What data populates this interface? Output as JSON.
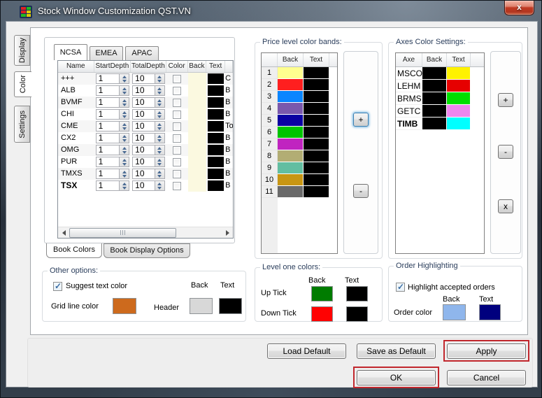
{
  "window": {
    "title": "Stock Window Customization QST.VN",
    "close_glyph": "x"
  },
  "annotation_color": "#C1272D",
  "side_tabs": [
    {
      "label": "Display",
      "active": false
    },
    {
      "label": "Color",
      "active": true
    },
    {
      "label": "Settings",
      "active": false
    }
  ],
  "book": {
    "region_tabs": [
      {
        "label": "NCSA",
        "active": true
      },
      {
        "label": "EMEA",
        "active": false
      },
      {
        "label": "APAC",
        "active": false
      }
    ],
    "columns": {
      "name": "Name",
      "start": "StartDepth",
      "total": "TotalDepth",
      "color": "Color",
      "back": "Back",
      "text": "Text"
    },
    "rows": [
      {
        "name": "+++",
        "start": "1",
        "total": "10",
        "color_checked": false,
        "back": "#FBF9E0",
        "text": "#000000",
        "more": "C",
        "bold": false
      },
      {
        "name": "ALB",
        "start": "1",
        "total": "10",
        "color_checked": false,
        "back": "#FBF9E0",
        "text": "#000000",
        "more": "B",
        "bold": false
      },
      {
        "name": "BVMF",
        "start": "1",
        "total": "10",
        "color_checked": false,
        "back": "#FBF9E0",
        "text": "#000000",
        "more": "B",
        "bold": false
      },
      {
        "name": "CHI",
        "start": "1",
        "total": "10",
        "color_checked": false,
        "back": "#FBF9E0",
        "text": "#000000",
        "more": "B",
        "bold": false
      },
      {
        "name": "CME",
        "start": "1",
        "total": "10",
        "color_checked": false,
        "back": "#FBF9E0",
        "text": "#000000",
        "more": "To",
        "bold": false
      },
      {
        "name": "CX2",
        "start": "1",
        "total": "10",
        "color_checked": false,
        "back": "#FBF9E0",
        "text": "#000000",
        "more": "B",
        "bold": false
      },
      {
        "name": "OMG",
        "start": "1",
        "total": "10",
        "color_checked": false,
        "back": "#FBF9E0",
        "text": "#000000",
        "more": "B",
        "bold": false
      },
      {
        "name": "PUR",
        "start": "1",
        "total": "10",
        "color_checked": false,
        "back": "#FBF9E0",
        "text": "#000000",
        "more": "B",
        "bold": false
      },
      {
        "name": "TMXS",
        "start": "1",
        "total": "10",
        "color_checked": false,
        "back": "#FBF9E0",
        "text": "#000000",
        "more": "B",
        "bold": false
      },
      {
        "name": "TSX",
        "start": "1",
        "total": "10",
        "color_checked": false,
        "back": "#FBF9E0",
        "text": "#000000",
        "more": "B",
        "bold": true
      }
    ],
    "bottom_tabs": [
      {
        "label": "Book Colors",
        "active": true
      },
      {
        "label": "Book Display Options",
        "active": false
      }
    ]
  },
  "price_bands": {
    "title": "Price level color bands:",
    "col_back": "Back",
    "col_text": "Text",
    "rows": [
      {
        "level": "1",
        "back": "#FFFF8F",
        "text": "#000000"
      },
      {
        "level": "2",
        "back": "#FF1F1F",
        "text": "#000000"
      },
      {
        "level": "3",
        "back": "#0A85FF",
        "text": "#000000"
      },
      {
        "level": "4",
        "back": "#7A58AC",
        "text": "#000000"
      },
      {
        "level": "5",
        "back": "#0B00A2",
        "text": "#000000"
      },
      {
        "level": "6",
        "back": "#00C400",
        "text": "#000000"
      },
      {
        "level": "7",
        "back": "#C024C0",
        "text": "#000000"
      },
      {
        "level": "8",
        "back": "#B2AD74",
        "text": "#000000"
      },
      {
        "level": "9",
        "back": "#62BEA1",
        "text": "#000000"
      },
      {
        "level": "10",
        "back": "#C89613",
        "text": "#000000"
      },
      {
        "level": "11",
        "back": "#6A6A6A",
        "text": "#000000"
      }
    ],
    "add_label": "+",
    "remove_label": "-"
  },
  "axes": {
    "title": "Axes Color Settings:",
    "col_axe": "Axe",
    "col_back": "Back",
    "col_text": "Text",
    "rows": [
      {
        "axe": "MSCO",
        "back": "#000000",
        "text": "#FFF200",
        "bold": false
      },
      {
        "axe": "LEHM",
        "back": "#000000",
        "text": "#E60000",
        "bold": false
      },
      {
        "axe": "BRMS",
        "back": "#000000",
        "text": "#00DE00",
        "bold": false
      },
      {
        "axe": "GETC",
        "back": "#000000",
        "text": "#EE86EE",
        "bold": false
      },
      {
        "axe": "TIMB",
        "back": "#000000",
        "text": "#00FFFF",
        "bold": true
      }
    ],
    "add_label": "+",
    "remove_label": "-",
    "delete_label": "x"
  },
  "other_options": {
    "title": "Other options:",
    "suggest": {
      "label": "Suggest  text color",
      "checked": true
    },
    "grid_line_label": "Grid line color",
    "grid_line_color": "#CD6A1D",
    "col_back": "Back",
    "col_text": "Text",
    "header_label": "Header",
    "header_back": "#D8D8D8",
    "header_text": "#000000"
  },
  "level_one": {
    "title": "Level one colors:",
    "col_back": "Back",
    "col_text": "Text",
    "rows": [
      {
        "label": "Up Tick",
        "back": "#007C00",
        "text": "#000000"
      },
      {
        "label": "Down Tick",
        "back": "#FF0202",
        "text": "#000000"
      }
    ]
  },
  "order_highlighting": {
    "title": "Order Highlighting",
    "highlight": {
      "label": "Highlight accepted orders",
      "checked": true
    },
    "col_back": "Back",
    "col_text": "Text",
    "order_color_label": "Order color",
    "back": "#8FB6EC",
    "text": "#00007E"
  },
  "footer": {
    "load_default": "Load Default",
    "save_default": "Save as Default",
    "apply": "Apply",
    "ok": "OK",
    "cancel": "Cancel"
  }
}
